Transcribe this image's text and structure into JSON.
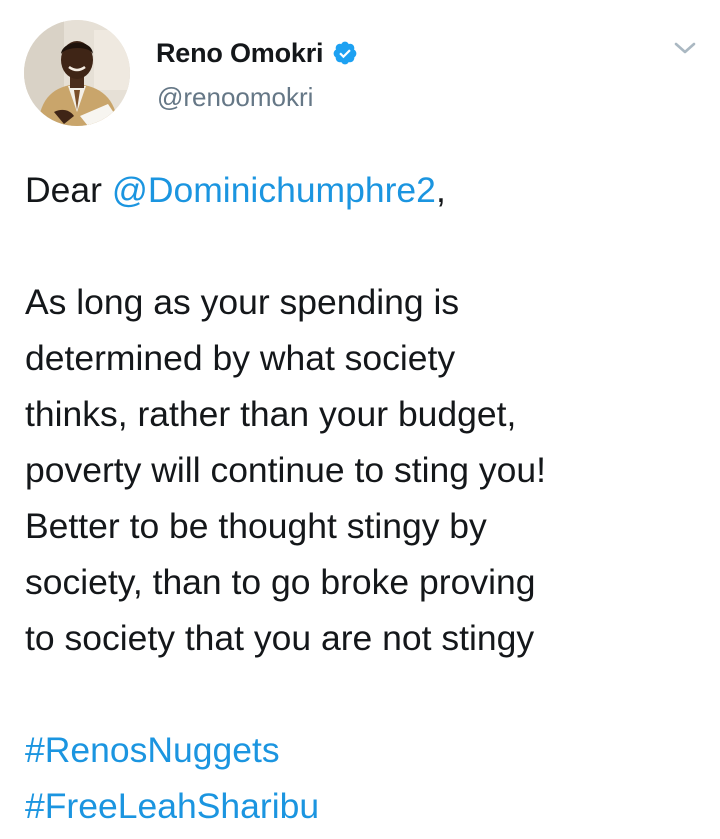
{
  "tweet": {
    "author": {
      "display_name": "Reno Omokri",
      "handle": "@renoomokri",
      "verified": true
    },
    "greeting_prefix": "Dear ",
    "mention": "@Dominichumphre2",
    "greeting_suffix": ",",
    "body_lines": [
      "As long as your spending is",
      "determined by what society",
      "thinks, rather than your budget,",
      "poverty will continue to sting you!",
      "Better to be thought stingy by",
      "society, than to go broke proving",
      "to society that you are not stingy"
    ],
    "hashtags": [
      "#RenosNuggets",
      "#FreeLeahSharibu"
    ]
  },
  "icons": {
    "verified": "verified-badge-icon",
    "menu": "chevron-down-icon"
  },
  "colors": {
    "link": "#1b95e0",
    "text": "#14171a",
    "secondary": "#657786",
    "verified": "#1da1f2"
  }
}
